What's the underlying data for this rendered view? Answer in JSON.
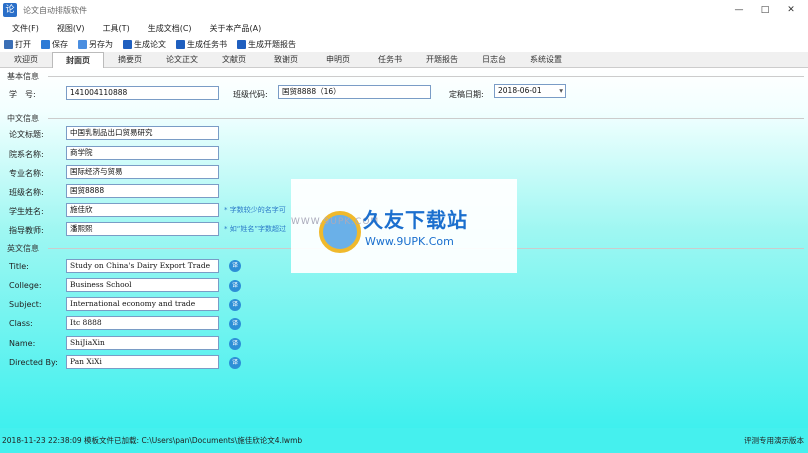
{
  "window": {
    "app_icon_glyph": "论",
    "title": "论文自动排版软件",
    "controls": [
      "—",
      "□",
      "✕"
    ]
  },
  "menu": [
    "文件(F)",
    "视图(V)",
    "工具(T)",
    "生成文档(C)",
    "关于本产品(A)"
  ],
  "toolbar": [
    {
      "label": "打开",
      "icon": "folder-open-icon"
    },
    {
      "label": "保存",
      "icon": "save-icon"
    },
    {
      "label": "另存为",
      "icon": "save-as-icon"
    },
    {
      "label": "生成论文",
      "icon": "document-icon"
    },
    {
      "label": "生成任务书",
      "icon": "document-icon"
    },
    {
      "label": "生成开题报告",
      "icon": "document-icon"
    }
  ],
  "tabs": [
    "欢迎页",
    "封面页",
    "摘要页",
    "论文正文",
    "文献页",
    "致谢页",
    "申明页",
    "任务书",
    "开题报告",
    "日志台",
    "系统设置"
  ],
  "active_tab": "封面页",
  "basic_info": {
    "section_title": "基本信息",
    "student_id_label": "学　号:",
    "student_id": "141004110888",
    "class_code_label": "班级代码:",
    "class_code": "国贸8888（16）",
    "date_label": "定稿日期:",
    "date": "2018-06-01"
  },
  "chinese_info": {
    "section_title": "中文信息",
    "fields": [
      {
        "label": "论文标题:",
        "value": "中国乳制品出口贸易研究"
      },
      {
        "label": "院系名称:",
        "value": "商学院"
      },
      {
        "label": "专业名称:",
        "value": "国际经济与贸易"
      },
      {
        "label": "班级名称:",
        "value": "国贸8888"
      },
      {
        "label": "学生姓名:",
        "value": "施佳欣"
      },
      {
        "label": "指导教师:",
        "value": "潘熙熙"
      }
    ],
    "hint_1": "* 字数较少的名字可",
    "hint_2": "* 如“姓名”字数超过"
  },
  "english_info": {
    "section_title": "英文信息",
    "translate_glyph": "译",
    "fields": [
      {
        "label": "Title:",
        "value": "Study on China's Dairy Export Trade"
      },
      {
        "label": "College:",
        "value": "Business School"
      },
      {
        "label": "Subject:",
        "value": "International economy and trade"
      },
      {
        "label": "Class:",
        "value": "Itc 8888"
      },
      {
        "label": "Name:",
        "value": "ShiJiaXin"
      },
      {
        "label": "Directed By:",
        "value": "Pan XiXi"
      }
    ]
  },
  "watermark": {
    "site": "WWW.9UPK.COM",
    "title": "久友下载站",
    "url": "Www.9UPK.Com"
  },
  "status": {
    "left": "2018-11-23 22:38:09  模板文件已加载: C:\\Users\\pan\\Documents\\施佳欣论文4.lwmb",
    "right": "评测专用演示版本"
  },
  "colors": {
    "accent": "#2d8fd6",
    "content_bottom": "#3ff0ee",
    "statusbar": "#45f0ee"
  }
}
